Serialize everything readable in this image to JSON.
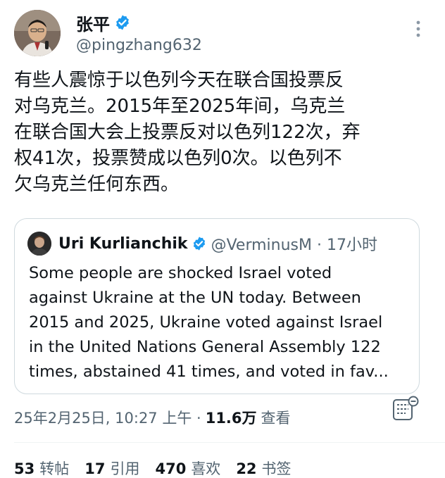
{
  "tweet": {
    "author": {
      "display_name": "张平",
      "handle": "@pingzhang632",
      "verified": true
    },
    "text": "有些人震惊于以色列今天在联合国投票反\n对乌克兰。2015年至2025年间，乌克兰\n在联合国大会上投票反对以色列122次，弃\n权41次，投票赞成以色列0次。以色列不\n欠乌克兰任何东西。",
    "quote": {
      "display_name": "Uri Kurlianchik",
      "handle_time": "@VerminusM · 17小时",
      "verified": true,
      "text": "Some people are shocked Israel voted\nagainst Ukraine at the UN today. Between\n2015 and 2025, Ukraine voted against Israel\nin the United Nations General Assembly 122\ntimes, abstained 41 times, and voted in fav..."
    },
    "meta": {
      "timestamp": "25年2月25日, 10:27 上午 ·",
      "views_count": "11.6万",
      "views_label": "查看"
    },
    "stats": [
      {
        "count": "53",
        "label": "转帖"
      },
      {
        "count": "17",
        "label": "引用"
      },
      {
        "count": "470",
        "label": "喜欢"
      },
      {
        "count": "22",
        "label": "书签"
      }
    ]
  },
  "icons": {
    "verified": "verified-badge-icon",
    "more": "more-vertical-icon",
    "analytics": "analytics-icon"
  },
  "colors": {
    "verified_blue": "#1d9bf0",
    "secondary_text": "#536471",
    "primary_text": "#0f1419",
    "border": "#cfd9de"
  }
}
